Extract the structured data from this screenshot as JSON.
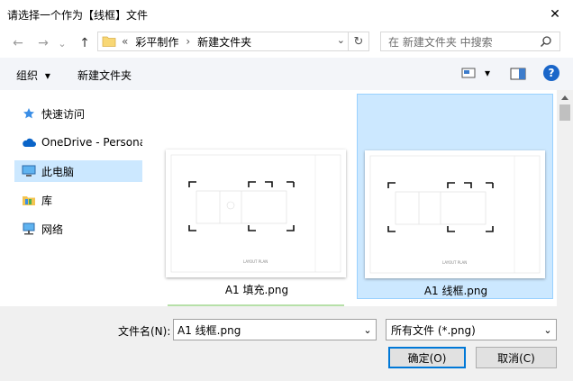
{
  "window": {
    "title": "请选择一个作为【线框】文件",
    "close": "✕"
  },
  "nav": {
    "back": "←",
    "forward": "→",
    "history": "⌄",
    "up": "↑",
    "refresh": "↻"
  },
  "address": {
    "prefix": "«",
    "crumb1": "彩平制作",
    "sep": "›",
    "crumb2": "新建文件夹",
    "dropdown": "⌄"
  },
  "search": {
    "placeholder": "在 新建文件夹 中搜索"
  },
  "toolbar": {
    "organize": "组织",
    "organize_arrow": "▾",
    "new_folder": "新建文件夹",
    "view_arrow": "▾",
    "help": "?"
  },
  "sidebar": {
    "items": [
      {
        "label": "快速访问",
        "icon": "star-icon"
      },
      {
        "label": "OneDrive - Persona",
        "icon": "cloud-icon"
      },
      {
        "label": "此电脑",
        "icon": "computer-icon"
      },
      {
        "label": "库",
        "icon": "library-icon"
      },
      {
        "label": "网络",
        "icon": "network-icon"
      }
    ]
  },
  "files": [
    {
      "name": "A1 填充.png",
      "thumb_caption": "LAYOUT PLAN",
      "selected": false
    },
    {
      "name": "A1 线框.png",
      "thumb_caption": "LAYOUT PLAN",
      "selected": true
    }
  ],
  "bottom": {
    "filename_label": "文件名(N):",
    "filename_value": "A1 线框.png",
    "filetype_value": "所有文件 (*.png)",
    "ok": "确定(O)",
    "cancel": "取消(C)"
  },
  "colors": {
    "selection": "#cce8ff",
    "accent": "#0078d7",
    "help": "#1a66c9"
  }
}
